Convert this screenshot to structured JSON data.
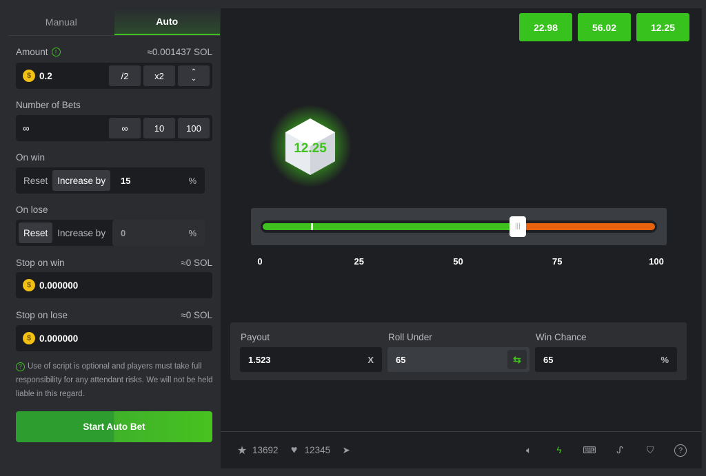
{
  "tabs": {
    "manual": "Manual",
    "auto": "Auto"
  },
  "amount": {
    "label": "Amount",
    "approx": "≈0.001437 SOL",
    "value": "0.2",
    "half": "/2",
    "double": "x2"
  },
  "bets": {
    "label": "Number of Bets",
    "value": "∞",
    "opt1": "∞",
    "opt2": "10",
    "opt3": "100"
  },
  "on_win": {
    "label": "On win",
    "reset": "Reset",
    "increase": "Increase by",
    "value": "15",
    "unit": "%"
  },
  "on_lose": {
    "label": "On lose",
    "reset": "Reset",
    "increase": "Increase by",
    "value": "0",
    "unit": "%"
  },
  "stop_win": {
    "label": "Stop on win",
    "approx": "≈0 SOL",
    "value": "0.000000"
  },
  "stop_lose": {
    "label": "Stop on lose",
    "approx": "≈0 SOL",
    "value": "0.000000"
  },
  "note": "Use of script is optional and players must take full responsibility for any attendant risks. We will not be held liable in this regard.",
  "start_label": "Start Auto Bet",
  "history": [
    "22.98",
    "56.02",
    "12.25"
  ],
  "dice_result": "12.25",
  "slider": {
    "value": 65,
    "marker": 12.25,
    "ticks": [
      "0",
      "25",
      "50",
      "75",
      "100"
    ],
    "win_color": "#3fc21e",
    "lose_color": "#e8620e"
  },
  "payout": {
    "label": "Payout",
    "value": "1.523",
    "unit": "X"
  },
  "roll_under": {
    "label": "Roll Under",
    "value": "65"
  },
  "win_chance": {
    "label": "Win Chance",
    "value": "65",
    "unit": "%"
  },
  "footer": {
    "stars": "13692",
    "likes": "12345"
  },
  "accent": "#3fc21e"
}
